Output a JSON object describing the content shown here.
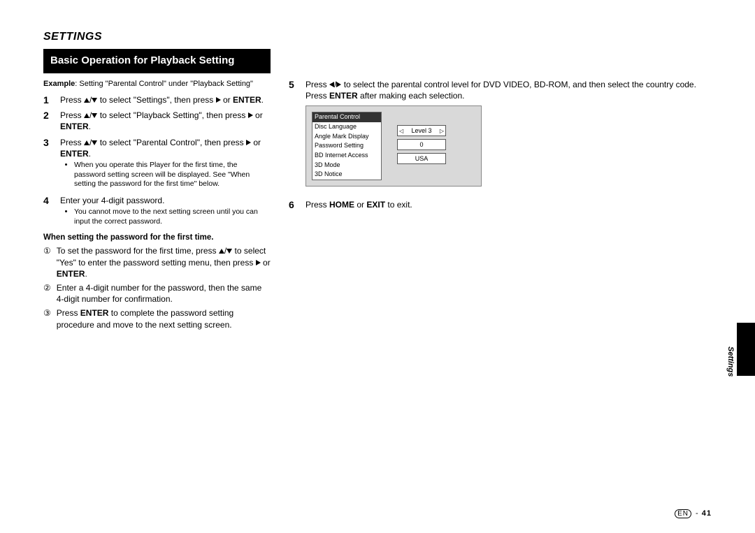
{
  "header": {
    "section": "SETTINGS"
  },
  "title": "Basic Operation for Playback Setting",
  "exampleLabel": "Example",
  "exampleText": ": Setting \"Parental Control\" under \"Playback Setting\"",
  "steps": {
    "s1_a": "Press ",
    "s1_b": " to select \"Settings\", then press ",
    "s1_c": " or ",
    "s1_enter": "ENTER",
    "s1_d": ".",
    "s2_a": "Press ",
    "s2_b": " to select \"Playback Setting\", then press ",
    "s2_c": " or ",
    "s2_enter": "ENTER",
    "s2_d": ".",
    "s3_a": "Press ",
    "s3_b": " to select \"Parental Control\", then press ",
    "s3_c": " or ",
    "s3_enter": "ENTER",
    "s3_d": ".",
    "s3_note": "When you operate this Player for the first time, the password setting screen will be displayed. See \"When setting the password for the first time\" below.",
    "s4": "Enter your 4-digit password.",
    "s4_note": "You cannot move to the next setting screen until you can input the correct password.",
    "subsection": "When setting the password for the first time.",
    "c1_a": "To set the password for the first time, press ",
    "c1_b": " to select \"Yes\" to enter the password setting menu, then press ",
    "c1_c": " or ",
    "c1_enter": "ENTER",
    "c1_d": ".",
    "c2": "Enter a 4-digit number for the password, then the same 4-digit number for confirmation.",
    "c3_a": "Press ",
    "c3_enter": "ENTER",
    "c3_b": " to complete the password setting procedure and move to the next setting screen.",
    "s5_a": "Press ",
    "s5_b": " to select the parental control level for DVD VIDEO, BD-ROM, and then select the country code. Press ",
    "s5_enter": "ENTER",
    "s5_c": " after making each selection.",
    "s6_a": "Press ",
    "s6_home": "HOME",
    "s6_b": " or ",
    "s6_exit": "EXIT",
    "s6_c": " to exit."
  },
  "osd": {
    "menuSelected": "Parental Control",
    "menuItems": [
      "Disc Language",
      "Angle Mark Display",
      "Password Setting",
      "BD Internet Access",
      "3D Mode",
      "3D Notice"
    ],
    "field1": "Level 3",
    "field2": "0",
    "field3": "USA"
  },
  "sideLabel": "Settings",
  "footer": {
    "lang": "EN",
    "sep": " - ",
    "page": "41"
  }
}
